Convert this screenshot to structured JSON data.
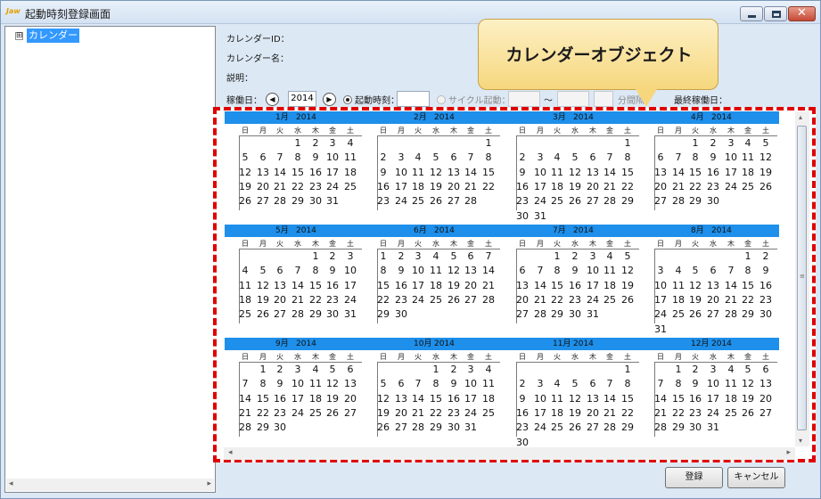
{
  "window": {
    "title": "起動時刻登録画面",
    "app_icon_text": "Jaw"
  },
  "controls": {
    "minimize_glyph": "",
    "maximize_glyph": "",
    "close_glyph": "✕"
  },
  "tree": {
    "expander": "⊞",
    "root_label": "カレンダー"
  },
  "fields": {
    "calendar_id_label": "カレンダーID：",
    "calendar_name_label": "カレンダー名：",
    "description_label": "説明："
  },
  "toolbar": {
    "working_day_label": "稼働日：",
    "prev_glyph": "◀",
    "next_glyph": "▶",
    "year": "2014",
    "start_time_label": "起動時刻：",
    "cycle_label": "サイクル起動：",
    "tilde": "～",
    "interval_label": "分間隔",
    "last_day_label": "最終稼働日："
  },
  "callout": {
    "text": "カレンダーオブジェクト"
  },
  "weekdays": [
    "日",
    "月",
    "火",
    "水",
    "木",
    "金",
    "土"
  ],
  "months": [
    {
      "name": "1月",
      "year": "2014",
      "first_weekday": 3,
      "days": 31
    },
    {
      "name": "2月",
      "year": "2014",
      "first_weekday": 6,
      "days": 28
    },
    {
      "name": "3月",
      "year": "2014",
      "first_weekday": 6,
      "days": 31
    },
    {
      "name": "4月",
      "year": "2014",
      "first_weekday": 2,
      "days": 30
    },
    {
      "name": "5月",
      "year": "2014",
      "first_weekday": 4,
      "days": 31
    },
    {
      "name": "6月",
      "year": "2014",
      "first_weekday": 0,
      "days": 30
    },
    {
      "name": "7月",
      "year": "2014",
      "first_weekday": 2,
      "days": 31
    },
    {
      "name": "8月",
      "year": "2014",
      "first_weekday": 5,
      "days": 31
    },
    {
      "name": "9月",
      "year": "2014",
      "first_weekday": 1,
      "days": 30
    },
    {
      "name": "10月",
      "year": "2014",
      "first_weekday": 3,
      "days": 31
    },
    {
      "name": "11月",
      "year": "2014",
      "first_weekday": 6,
      "days": 30
    },
    {
      "name": "12月",
      "year": "2014",
      "first_weekday": 1,
      "days": 31
    }
  ],
  "buttons": {
    "register": "登録",
    "cancel": "キャンセル"
  },
  "scroll": {
    "left": "◂",
    "right": "▸",
    "up": "▴",
    "down": "▾",
    "grip": "≡"
  }
}
